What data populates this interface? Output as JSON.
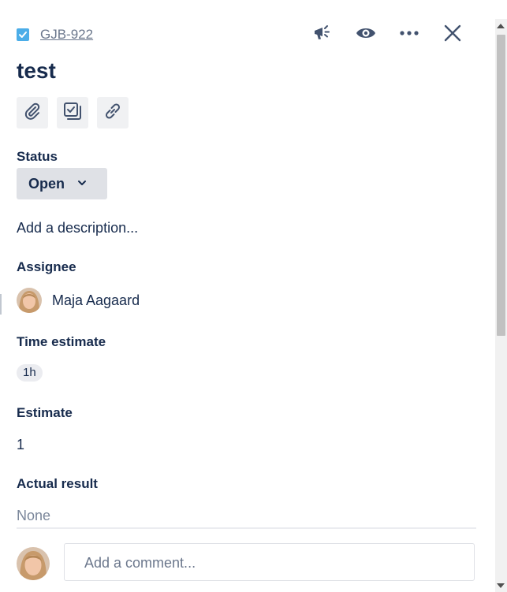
{
  "issue": {
    "key": "GJB-922",
    "title": "test"
  },
  "header_actions": [
    {
      "icon": "megaphone-icon"
    },
    {
      "icon": "eye-icon"
    },
    {
      "icon": "more-icon"
    },
    {
      "icon": "close-icon"
    }
  ],
  "toolbar": [
    {
      "icon": "attachment-icon"
    },
    {
      "icon": "subtask-icon"
    },
    {
      "icon": "link-icon"
    }
  ],
  "status": {
    "label": "Status",
    "value": "Open"
  },
  "description": {
    "placeholder": "Add a description..."
  },
  "assignee": {
    "label": "Assignee",
    "name": "Maja Aagaard"
  },
  "time_estimate": {
    "label": "Time estimate",
    "value": "1h"
  },
  "estimate": {
    "label": "Estimate",
    "value": "1"
  },
  "actual_result": {
    "label": "Actual result",
    "value": "None"
  },
  "comment": {
    "placeholder": "Add a comment..."
  },
  "colors": {
    "text": "#172b4d",
    "subtle": "#6b778c",
    "checkbox": "#4bade8",
    "button_bg": "#f0f1f3",
    "status_bg": "#dfe1e6"
  }
}
